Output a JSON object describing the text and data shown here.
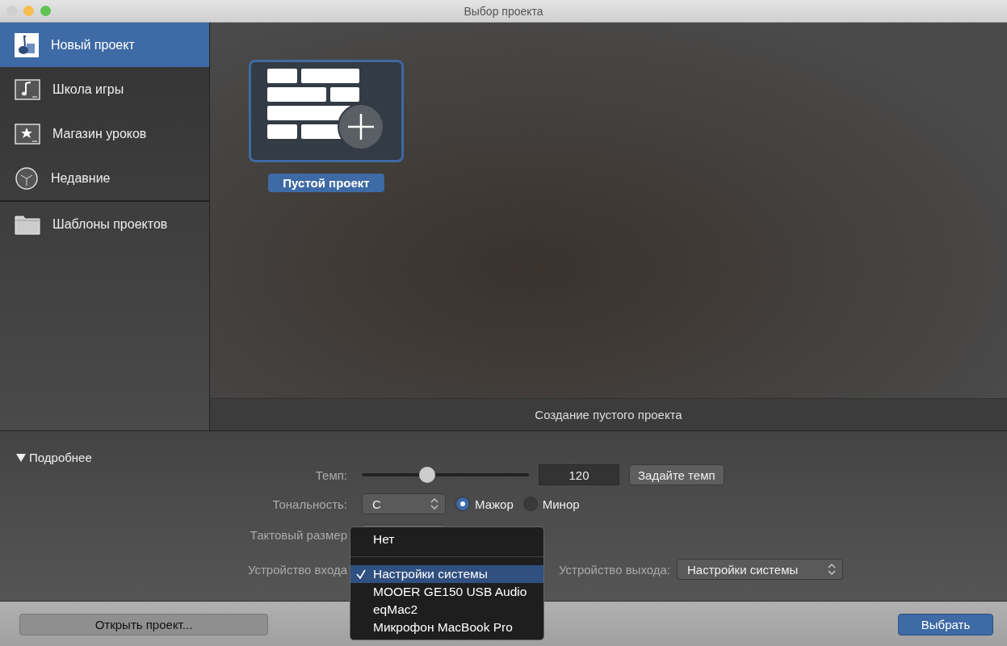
{
  "window": {
    "title": "Выбор проекта"
  },
  "sidebar": {
    "sections": [
      [
        {
          "label": "Новый проект",
          "selected": true
        },
        {
          "label": "Школа игры",
          "selected": false
        },
        {
          "label": "Магазин уроков",
          "selected": false
        },
        {
          "label": "Недавние",
          "selected": false
        }
      ],
      [
        {
          "label": "Шаблоны проектов",
          "selected": false
        }
      ]
    ]
  },
  "templates": [
    {
      "label": "Пустой проект",
      "selected": true
    }
  ],
  "caption": "Создание пустого проекта",
  "details": {
    "toggle": "Подробнее",
    "expanded": true,
    "tempo": {
      "label": "Темп:",
      "level": 0.39,
      "value": "120",
      "button": "Задайте темп"
    },
    "key": {
      "label": "Тональность:",
      "value": "C",
      "modes": [
        {
          "label": "Мажор",
          "selected": true
        },
        {
          "label": "Минор",
          "selected": false
        }
      ]
    },
    "time_signature": {
      "label": "Тактовый размер"
    },
    "input": {
      "label": "Устройство входа"
    },
    "output": {
      "label": "Устройство выхода:",
      "value": "Настройки системы"
    }
  },
  "input_menu": [
    {
      "kind": "item",
      "label": "Нет",
      "selected": false
    },
    {
      "kind": "separator"
    },
    {
      "kind": "item",
      "label": "Настройки системы",
      "selected": true
    },
    {
      "kind": "item",
      "label": "MOOER GE150 USB Audio",
      "selected": false
    },
    {
      "kind": "item",
      "label": "eqMac2",
      "selected": false
    },
    {
      "kind": "item",
      "label": "Микрофон MacBook Pro",
      "selected": false
    }
  ],
  "footer": {
    "open_button": "Открыть проект...",
    "choose_button": "Выбрать"
  }
}
